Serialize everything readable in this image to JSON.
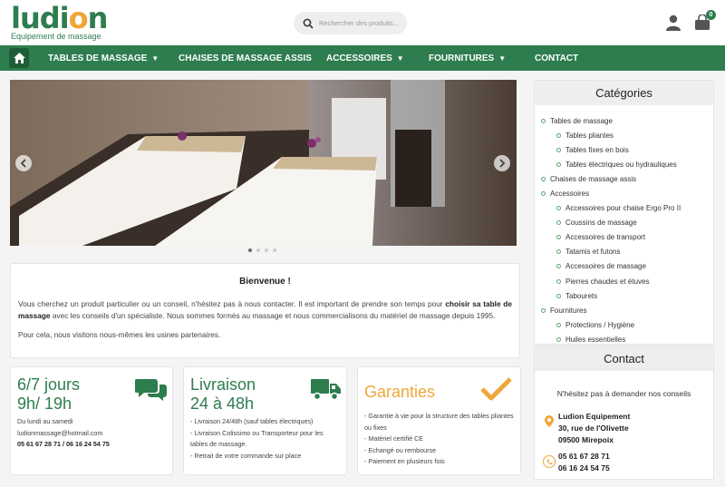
{
  "brand": {
    "name": "ludion",
    "tagline": "Equipement de massage",
    "color": "#2e7d4f",
    "accent": "#f0a63a"
  },
  "search": {
    "placeholder": "Rechercher des produits..."
  },
  "header": {
    "cart_count": "0",
    "icons": [
      "search-icon",
      "user-icon",
      "cart-icon"
    ]
  },
  "nav": {
    "items": [
      {
        "label": "Tables de massage",
        "dropdown": true
      },
      {
        "label": "Chaises de massage assis",
        "dropdown": false
      },
      {
        "label": "Accessoires",
        "dropdown": true
      },
      {
        "label": "Fournitures",
        "dropdown": true
      },
      {
        "label": "Contact",
        "dropdown": false
      }
    ]
  },
  "slider": {
    "slides": 4,
    "active": 1
  },
  "welcome": {
    "title": "Bienvenue !",
    "p1_a": "Vous cherchez un produit particulier ou un conseil, n'hésitez pas à nous contacter. Il est important de prendre son temps pour ",
    "p1_b": "choisir sa table de massage",
    "p1_c": " avec les conseils d'un spécialiste. Nous sommes formés au massage et nous commercialisons du matériel de massage depuis 1995.",
    "p2": "Pour cela, nous visitons nous-mêmes les usines partenaires."
  },
  "cards": {
    "hours": {
      "line1": "6/7 jours",
      "line2": "9h/ 19h",
      "days": "Du lundi au samedi",
      "email": "ludionmassage@hotmail.com",
      "phones": "05 61 67 28 71 / 06 16 24 54 75"
    },
    "delivery": {
      "line1": "Livraison",
      "line2": "24 à 48h",
      "items": [
        "- Livraison 24/48h (sauf tables électriques)",
        "- Livraison Colissimo ou Transporteur pour les tables de massage.",
        "- Retrait de votre commande sur place"
      ]
    },
    "guarantee": {
      "title": "Garanties",
      "items": [
        "- Garantie à vie pour la structure des tables pliantes ou fixes",
        "- Matériel certifié CE",
        "- Echangé ou rembourse",
        "- Paiement en plusieurs fois"
      ]
    }
  },
  "sidebar": {
    "title": "Catégories",
    "categories": [
      {
        "label": "Tables de massage",
        "level": 0
      },
      {
        "label": "Tables pliantes",
        "level": 1
      },
      {
        "label": "Tables fixes en bois",
        "level": 1
      },
      {
        "label": "Tables électriques ou hydrauliques",
        "level": 1
      },
      {
        "label": "Chaises de massage assis",
        "level": 0
      },
      {
        "label": "Accessoires",
        "level": 0
      },
      {
        "label": "Accessoires pour chaise Ergo Pro II",
        "level": 1
      },
      {
        "label": "Coussins de massage",
        "level": 1
      },
      {
        "label": "Accessoires de transport",
        "level": 1
      },
      {
        "label": "Tatamis et futons",
        "level": 1
      },
      {
        "label": "Accessoires de massage",
        "level": 1
      },
      {
        "label": "Pierres chaudes et étuves",
        "level": 1
      },
      {
        "label": "Tabourets",
        "level": 1
      },
      {
        "label": "Fournitures",
        "level": 0
      },
      {
        "label": "Protections / Hygiène",
        "level": 1
      },
      {
        "label": "Huiles essentielles",
        "level": 1
      }
    ]
  },
  "contact": {
    "title": "Contact",
    "message": "N'hésitez pas à demander nos conseils",
    "company": "Ludion Equipement",
    "street": "30, rue de l'Olivette",
    "city": "09500 Mirepoix",
    "phone1": "05 61 67 28 71",
    "phone2": "06 16 24 54 75"
  }
}
